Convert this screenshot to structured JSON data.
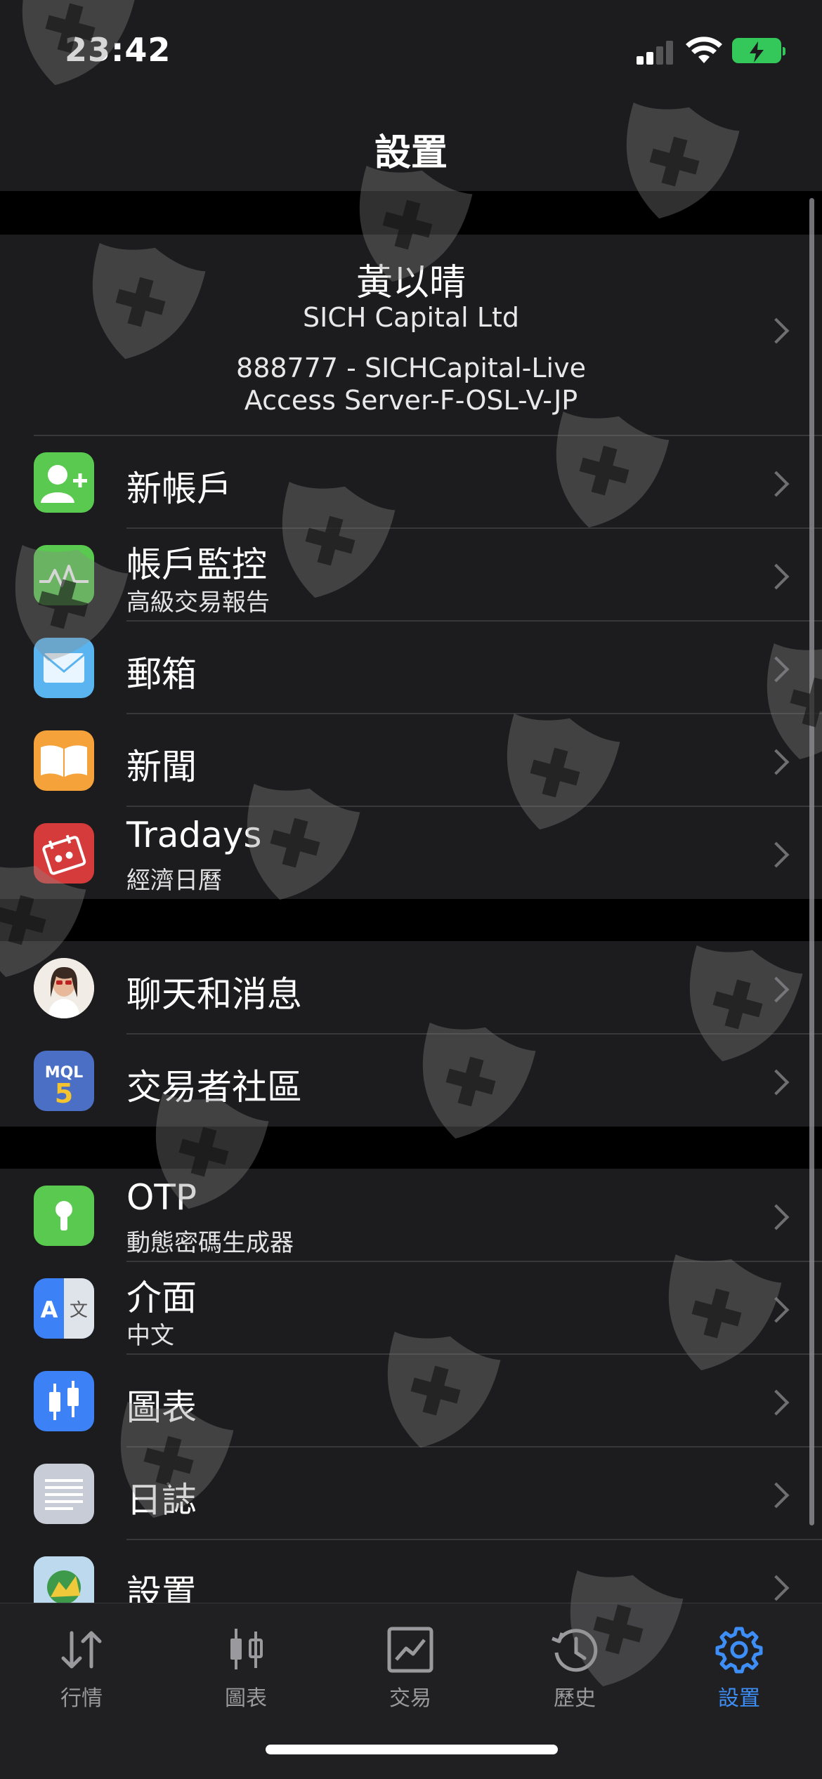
{
  "status_bar": {
    "time": "23:42"
  },
  "header": {
    "title": "設置"
  },
  "account": {
    "name": "黃以晴",
    "company": "SICH Capital Ltd",
    "login": "888777 - SICHCapital-Live",
    "server": "Access Server-F-OSL-V-JP"
  },
  "menu": {
    "new_account": {
      "label": "新帳戶",
      "icon": "add-user-icon",
      "color": "#5ac94f"
    },
    "monitor": {
      "label": "帳戶監控",
      "sub": "高級交易報告",
      "icon": "chart-wave-icon",
      "color": "#5ac94f"
    },
    "mailbox": {
      "label": "郵箱",
      "icon": "mail-icon",
      "color": "#5ab4f0"
    },
    "news": {
      "label": "新聞",
      "icon": "book-icon",
      "color": "#f5a23a"
    },
    "tradays": {
      "label": "Tradays",
      "sub": "經濟日曆",
      "icon": "calendar-icon",
      "color": "#d63b3b"
    },
    "chat": {
      "label": "聊天和消息",
      "icon": "avatar-photo"
    },
    "community": {
      "label": "交易者社區",
      "icon": "mql5-icon",
      "color": "#4a6fc4"
    },
    "otp": {
      "label": "OTP",
      "sub": "動態密碼生成器",
      "icon": "keyhole-icon",
      "color": "#5ac94f"
    },
    "interface": {
      "label": "介面",
      "sub": "中文",
      "icon": "translate-icon",
      "color": "#3c82f6"
    },
    "charts": {
      "label": "圖表",
      "icon": "candles-icon",
      "color": "#3c82f6"
    },
    "journal": {
      "label": "日誌",
      "icon": "lines-icon",
      "color": "#c8ccd6"
    },
    "settings": {
      "label": "設置",
      "icon": "metatrader-icon"
    }
  },
  "tabs": {
    "quotes": {
      "label": "行情",
      "icon": "arrows-updown-icon"
    },
    "chart": {
      "label": "圖表",
      "icon": "candles-icon"
    },
    "trade": {
      "label": "交易",
      "icon": "trade-chart-icon"
    },
    "history": {
      "label": "歷史",
      "icon": "history-icon"
    },
    "settings": {
      "label": "設置",
      "icon": "gear-icon",
      "active": true,
      "active_color": "#3e8ef7"
    }
  }
}
